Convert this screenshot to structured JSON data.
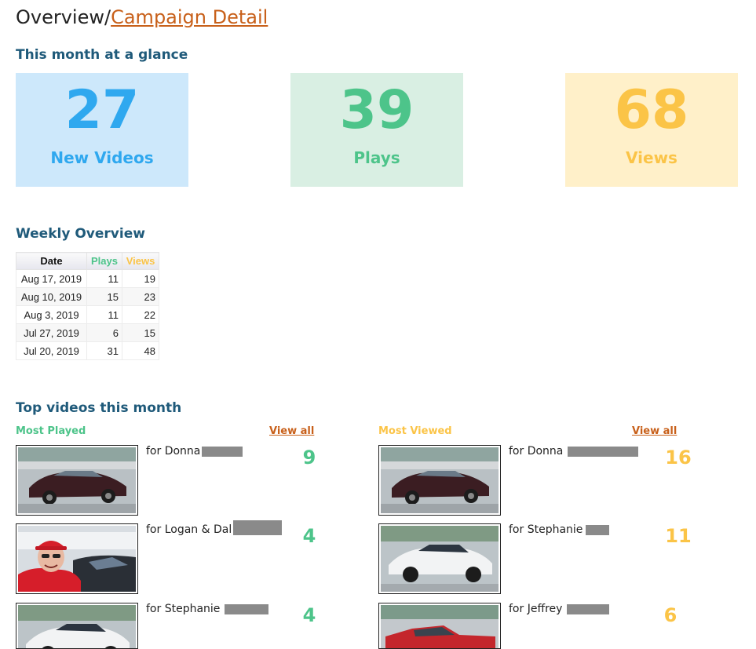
{
  "breadcrumb": {
    "root": "Overview",
    "separator": "/",
    "current": "Campaign Detail"
  },
  "glance": {
    "title": "This month at a glance",
    "stats": [
      {
        "value": "27",
        "label": "New Videos",
        "color": "#2fa8ef"
      },
      {
        "value": "39",
        "label": "Plays",
        "color": "#4dc48a"
      },
      {
        "value": "68",
        "label": "Views",
        "color": "#fbc447"
      }
    ]
  },
  "weekly": {
    "title": "Weekly Overview",
    "headers": {
      "date": "Date",
      "plays": "Plays",
      "views": "Views"
    },
    "rows": [
      {
        "date": "Aug 17, 2019",
        "plays": "11",
        "views": "19"
      },
      {
        "date": "Aug 10, 2019",
        "plays": "15",
        "views": "23"
      },
      {
        "date": "Aug 3, 2019",
        "plays": "11",
        "views": "22"
      },
      {
        "date": "Jul 27, 2019",
        "plays": "6",
        "views": "15"
      },
      {
        "date": "Jul 20, 2019",
        "plays": "31",
        "views": "48"
      }
    ]
  },
  "top_videos": {
    "title": "Top videos this month",
    "most_played": {
      "label": "Most Played",
      "view_all": "View all",
      "items": [
        {
          "name": "for Donna",
          "count": "9",
          "thumb": "maroon-sedan"
        },
        {
          "name": "for Logan & Dal",
          "count": "4",
          "thumb": "person-red-cap"
        },
        {
          "name": "for Stephanie",
          "count": "4",
          "thumb": "white-suv"
        }
      ]
    },
    "most_viewed": {
      "label": "Most Viewed",
      "view_all": "View all",
      "items": [
        {
          "name": "for Donna",
          "count": "16",
          "thumb": "maroon-sedan"
        },
        {
          "name": "for Stephanie",
          "count": "11",
          "thumb": "white-suv"
        },
        {
          "name": "for Jeffrey",
          "count": "6",
          "thumb": "red-pickup"
        }
      ]
    }
  },
  "colors": {
    "link": "#c8601a",
    "heading": "#1f5a7a",
    "plays": "#4dc48a",
    "views": "#fbc447",
    "new_videos": "#2fa8ef"
  }
}
